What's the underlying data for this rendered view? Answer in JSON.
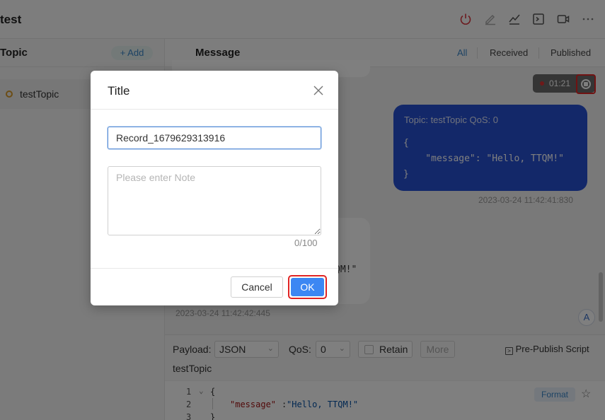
{
  "app": {
    "title": "test"
  },
  "header_icons": [
    "power-icon",
    "edit-icon",
    "chart-icon",
    "terminal-icon",
    "video-icon",
    "more-icon"
  ],
  "colors": {
    "accent": "#3a86c8",
    "published_bubble": "#2750d3",
    "ok_button": "#3c87f3",
    "highlight": "#e02424",
    "disconnect": "#d9363e"
  },
  "topics_panel": {
    "heading": "Topic",
    "add_label": "+ Add",
    "items": [
      {
        "name": "testTopic",
        "color": "#d89a2a"
      }
    ]
  },
  "messages_panel": {
    "heading": "Message",
    "filters": [
      "All",
      "Received",
      "Published"
    ],
    "active_filter": "All",
    "recording_time": "01:21",
    "published_message": {
      "meta": "Topic: testTopic  QoS: 0",
      "code": "{\n    \"message\": \"Hello, TTQM!\"\n}",
      "timestamp": "2023-03-24 11:42:41:830"
    },
    "received_message": {
      "visible_fragment": "QM!\"",
      "timestamp": "2023-03-24 11:42:42:445"
    },
    "avatar_letter": "A"
  },
  "publish_bar": {
    "payload_label": "Payload:",
    "payload_value": "JSON",
    "qos_label": "QoS:",
    "qos_value": "0",
    "retain_label": "Retain",
    "more_label": "More",
    "script_label": "Pre-Publish Script",
    "topic": "testTopic",
    "format_label": "Format",
    "editor_lines": [
      {
        "no": "1",
        "text": "{"
      },
      {
        "no": "2",
        "key": "\"message\"",
        "value": "\"Hello, TTQM!\""
      },
      {
        "no": "3",
        "text": "}"
      }
    ]
  },
  "dialog": {
    "title": "Title",
    "name_value": "Record_1679629313916",
    "note_placeholder": "Please enter Note",
    "char_count": "0/100",
    "cancel_label": "Cancel",
    "ok_label": "OK"
  }
}
